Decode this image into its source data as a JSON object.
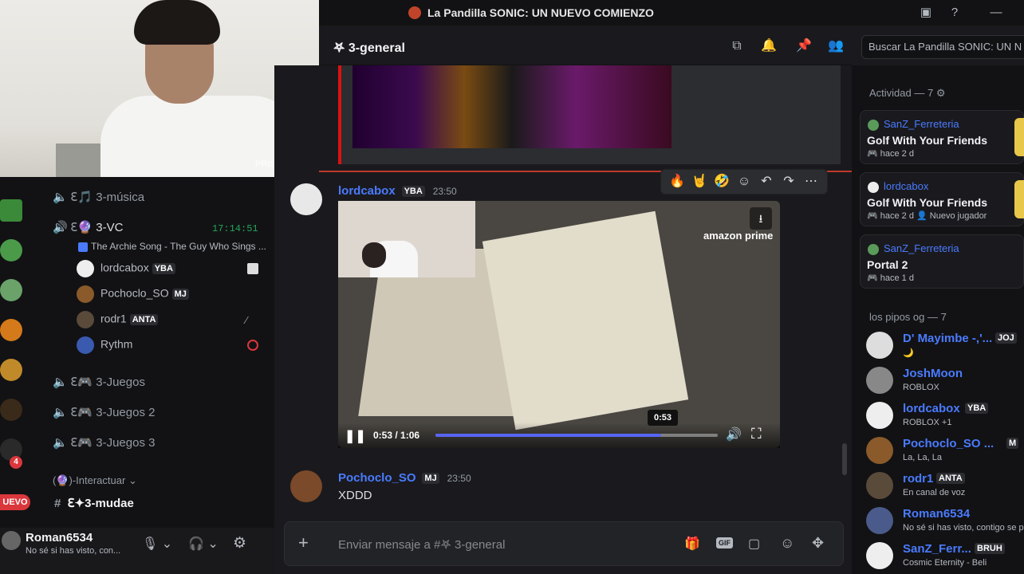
{
  "window": {
    "title": "La Pandilla SONIC: UN NUEVO COMIENZO"
  },
  "header": {
    "channel": "𖤐 3-general",
    "search_placeholder": "Buscar La Pandilla SONIC: UN N"
  },
  "webcam": {
    "watermark": "PRISMLive"
  },
  "sidebar": {
    "voice_channels": [
      {
        "name": "3-música"
      },
      {
        "name": "3-VC",
        "time": "17:14:51",
        "activity": "The Archie Song - The Guy Who Sings ..."
      },
      {
        "name": "3-Juegos"
      },
      {
        "name": "3-Juegos 2"
      },
      {
        "name": "3-Juegos 3"
      }
    ],
    "vc_users": [
      {
        "name": "lordcabox",
        "badge": "YBA"
      },
      {
        "name": "Pochoclo_SO",
        "badge": "MJ"
      },
      {
        "name": "rodr1",
        "badge": "ANTA"
      },
      {
        "name": "Rythm",
        "badge": ""
      }
    ],
    "category": "(🔮)-Interactuar",
    "text_channel": "3-mudae",
    "rail_badge": "4",
    "new_label": "UEVO"
  },
  "user": {
    "name": "Roman6534",
    "status": "No sé si has visto, con..."
  },
  "messages": [
    {
      "author": "lordcabox",
      "badge": "YBA",
      "time": "23:50"
    },
    {
      "author": "Pochoclo_SO",
      "badge": "MJ",
      "time": "23:50",
      "text": "XDDD"
    }
  ],
  "video": {
    "time": "0:53 / 1:06",
    "tooltip": "0:53",
    "progress": 0.8,
    "logo": "amazon prime"
  },
  "composer": {
    "placeholder": "Enviar mensaje a #𖤐 3-general"
  },
  "activity": {
    "header": "Actividad — 7",
    "cards": [
      {
        "user": "SanZ_Ferreteria",
        "game": "Golf With Your Friends",
        "meta": "hace 2 d",
        "extra": ""
      },
      {
        "user": "lordcabox",
        "game": "Golf With Your Friends",
        "meta": "hace 2 d",
        "extra": "Nuevo jugador"
      },
      {
        "user": "SanZ_Ferreteria",
        "game": "Portal 2",
        "meta": "hace 1 d",
        "extra": ""
      }
    ]
  },
  "members": {
    "header": "los pipos og — 7",
    "list": [
      {
        "name": "D' Mayimbe -,'...",
        "sub": "🌙",
        "badge": "JOJ"
      },
      {
        "name": "JoshMoon",
        "sub": "ROBLOX",
        "badge": ""
      },
      {
        "name": "lordcabox",
        "sub": "ROBLOX +1",
        "badge": "YBA"
      },
      {
        "name": "Pochoclo_SO ...",
        "sub": "La, La, La",
        "badge": "M"
      },
      {
        "name": "rodr1",
        "sub": "En canal de voz",
        "badge": "ANTA"
      },
      {
        "name": "Roman6534",
        "sub": "No sé si has visto, contigo se p",
        "badge": ""
      },
      {
        "name": "SanZ_Ferr...",
        "sub": "Cosmic Eternity - Beli",
        "badge": "BRUH"
      }
    ]
  },
  "colors": {
    "accent": "#5865f2",
    "link": "#4a7bff",
    "alert": "#da373c",
    "online": "#23a55a"
  }
}
